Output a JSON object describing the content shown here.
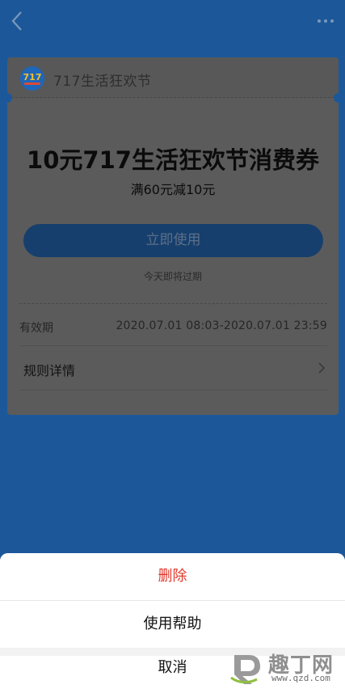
{
  "header": {
    "back_icon": "back-chevron-icon",
    "more_icon": "more-dots-icon"
  },
  "card": {
    "brand_name": "717生活狂欢节",
    "logo_text": "717",
    "title": "10元717生活狂欢节消费券",
    "condition": "满60元减10元",
    "use_button_label": "立即使用",
    "expire_note": "今天即将过期",
    "validity_label": "有效期",
    "validity_value": "2020.07.01 08:03-2020.07.01 23:59",
    "rules_label": "规则详情"
  },
  "action_sheet": {
    "delete_label": "删除",
    "help_label": "使用帮助",
    "cancel_label": "取消"
  },
  "watermark": {
    "text": "趣丁网",
    "url": "www.qzd.com"
  },
  "colors": {
    "page_bg": "#1c5899",
    "overlay_card": "#5b5b5b",
    "button": "#163f6d",
    "delete_red": "#e0372b"
  }
}
